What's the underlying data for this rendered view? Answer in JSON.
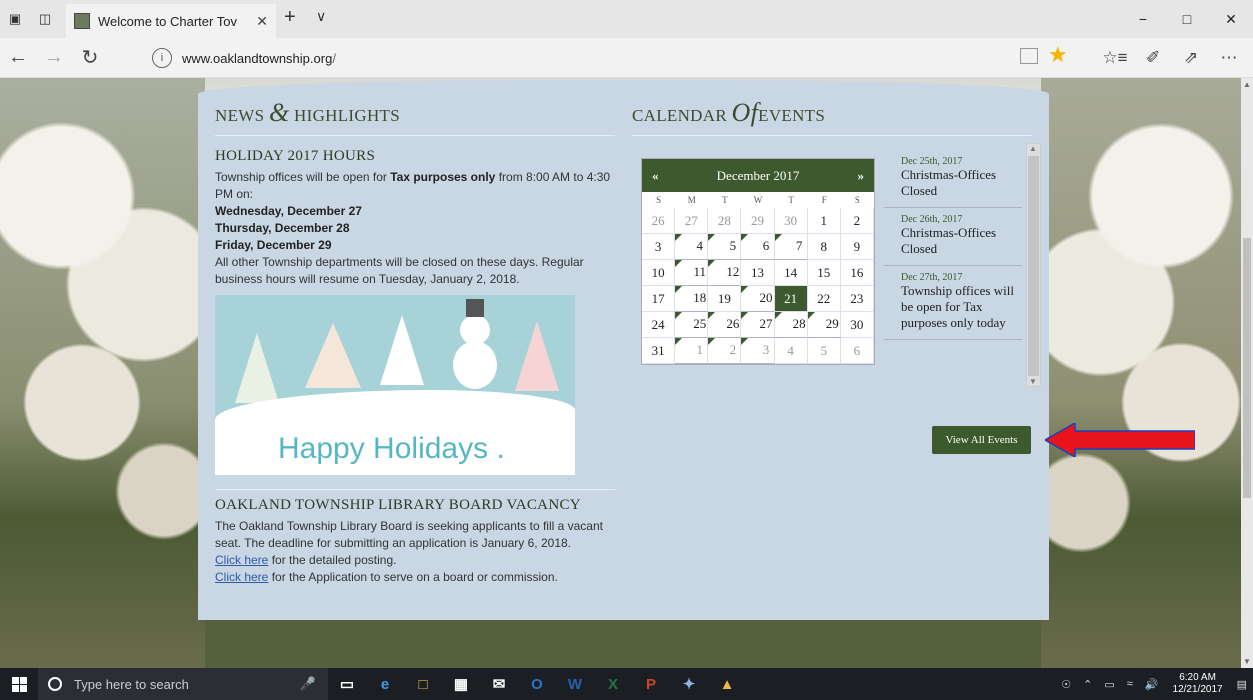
{
  "browser": {
    "tab_title": "Welcome to Charter Tov",
    "new_tab_symbol": "+",
    "tab_menu_symbol": "∨",
    "url_host": "www.oaklandtownship.org",
    "url_path": "/",
    "info_symbol": "i",
    "window_controls": [
      "−",
      "□",
      "✕"
    ],
    "nav_icons": {
      "back": "←",
      "forward": "→",
      "refresh": "↻"
    },
    "right_icons": [
      "☆≡",
      "✐",
      "⇗",
      "⋯"
    ]
  },
  "news": {
    "heading_pre": "NEWS",
    "heading_amp": "&",
    "heading_post": "HIGHLIGHTS",
    "article1": {
      "title": "HOLIDAY 2017 HOURS",
      "line1_pre": "Township offices will be open for ",
      "line1_bold": "Tax purposes only",
      "line1_post": " from 8:00 AM to 4:30 PM on:",
      "day1": "Wednesday, December 27",
      "day2": "Thursday, December 28",
      "day3": "Friday, December 29",
      "closing": "All other Township departments will be closed on these days. Regular business hours will resume on Tuesday, January 2, 2018.",
      "image_text": "Happy Holidays ."
    },
    "article2": {
      "title": "OAKLAND TOWNSHIP LIBRARY BOARD VACANCY",
      "body": "The Oakland Township Library Board is seeking applicants to fill a vacant seat. The deadline for submitting an application is January 6, 2018.",
      "link1": "Click here",
      "link1_after": " for the detailed posting.",
      "link2": "Click here",
      "link2_after": " for the Application to serve on a board or commission."
    }
  },
  "calendar": {
    "heading_pre": "CALENDAR",
    "heading_of": "Of",
    "heading_post": "EVENTS",
    "prev": "«",
    "next": "»",
    "month": "December 2017",
    "dow": [
      "S",
      "M",
      "T",
      "W",
      "T",
      "F",
      "S"
    ],
    "days": [
      {
        "d": "26",
        "o": true
      },
      {
        "d": "27",
        "o": true
      },
      {
        "d": "28",
        "o": true
      },
      {
        "d": "29",
        "o": true
      },
      {
        "d": "30",
        "o": true
      },
      {
        "d": "1"
      },
      {
        "d": "2"
      },
      {
        "d": "3"
      },
      {
        "d": "4",
        "e": true
      },
      {
        "d": "5",
        "e": true
      },
      {
        "d": "6",
        "e": true
      },
      {
        "d": "7",
        "e": true
      },
      {
        "d": "8"
      },
      {
        "d": "9"
      },
      {
        "d": "10"
      },
      {
        "d": "11",
        "e": true
      },
      {
        "d": "12",
        "e": true
      },
      {
        "d": "13"
      },
      {
        "d": "14"
      },
      {
        "d": "15"
      },
      {
        "d": "16"
      },
      {
        "d": "17"
      },
      {
        "d": "18",
        "e": true
      },
      {
        "d": "19"
      },
      {
        "d": "20",
        "e": true
      },
      {
        "d": "21",
        "t": true
      },
      {
        "d": "22"
      },
      {
        "d": "23"
      },
      {
        "d": "24"
      },
      {
        "d": "25",
        "e": true
      },
      {
        "d": "26",
        "e": true
      },
      {
        "d": "27",
        "e": true
      },
      {
        "d": "28",
        "e": true
      },
      {
        "d": "29",
        "e": true
      },
      {
        "d": "30"
      },
      {
        "d": "31"
      },
      {
        "d": "1",
        "o": true,
        "e": true
      },
      {
        "d": "2",
        "o": true,
        "e": true
      },
      {
        "d": "3",
        "o": true,
        "e": true
      },
      {
        "d": "4",
        "o": true
      },
      {
        "d": "5",
        "o": true
      },
      {
        "d": "6",
        "o": true
      }
    ],
    "events": [
      {
        "date": "Dec 25th, 2017",
        "title": "Christmas-Offices Closed"
      },
      {
        "date": "Dec 26th, 2017",
        "title": "Christmas-Offices Closed"
      },
      {
        "date": "Dec 27th, 2017",
        "title": "Township offices will be open for Tax purposes only today"
      }
    ],
    "view_all": "View All Events"
  },
  "taskbar": {
    "search_placeholder": "Type here to search",
    "time": "6:20 AM",
    "date": "12/21/2017"
  },
  "colors": {
    "accent_green": "#3c5a2d",
    "content_bg": "#c9d6e4",
    "annotation_arrow": "#e8141b"
  }
}
